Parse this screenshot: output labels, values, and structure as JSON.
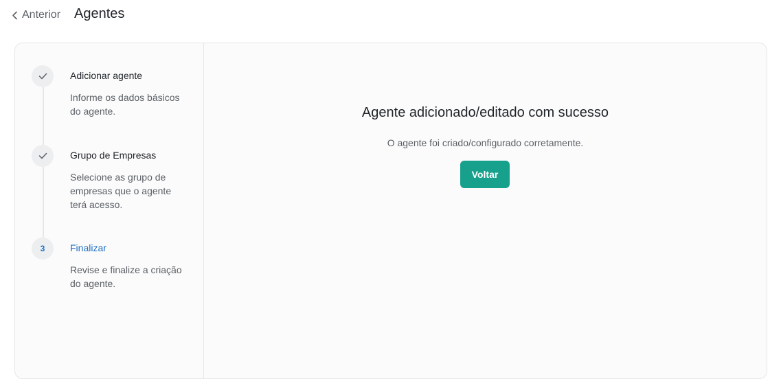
{
  "header": {
    "back_label": "Anterior",
    "title": "Agentes"
  },
  "steps": [
    {
      "state": "done",
      "icon": "check-icon",
      "label": "Adicionar agente",
      "description": "Informe os dados básicos do agente."
    },
    {
      "state": "done",
      "icon": "check-icon",
      "label": "Grupo de Empresas",
      "description": "Selecione as grupo de empresas que o agente terá acesso."
    },
    {
      "state": "active",
      "number": "3",
      "label": "Finalizar",
      "description": "Revise e finalize a criação do agente."
    }
  ],
  "result": {
    "title": "Agente adicionado/editado com sucesso",
    "subtitle": "O agente foi criado/configurado corretamente.",
    "button_label": "Voltar"
  },
  "colors": {
    "accent_button": "#17a08c",
    "active_step": "#1e6fc4",
    "step_circle": "#eceef0"
  }
}
